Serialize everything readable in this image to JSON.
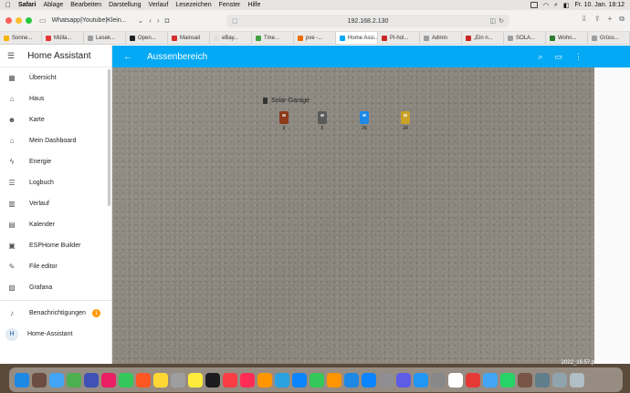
{
  "menubar": {
    "apple": "",
    "items": [
      "Safari",
      "Ablage",
      "Bearbeiten",
      "Darstellung",
      "Verlauf",
      "Lesezeichen",
      "Fenster",
      "Hilfe"
    ],
    "clock": "Fr. 10. Jan.  18:12"
  },
  "safari": {
    "tab_group": "Whatsapp|Youtube|Klein...",
    "url": "192.168.2.130",
    "bookmarks": [
      {
        "label": "Sonne...",
        "color": "#f4b400"
      },
      {
        "label": "Müllа...",
        "color": "#e53935"
      },
      {
        "label": "Lesek...",
        "color": "#9e9e9e"
      },
      {
        "label": "Open...",
        "color": "#222222"
      },
      {
        "label": "Mainsail",
        "color": "#d32f2f"
      },
      {
        "label": "eBay...",
        "color": "#e0e0e0"
      },
      {
        "label": "Tme...",
        "color": "#43a047"
      },
      {
        "label": "pve -...",
        "color": "#ef6c00"
      },
      {
        "label": "Home Assi...",
        "color": "#03a9f4"
      },
      {
        "label": "Pi-hol...",
        "color": "#c62828"
      },
      {
        "label": "Admin",
        "color": "#9e9e9e"
      },
      {
        "label": "„Ein n...",
        "color": "#c62828"
      },
      {
        "label": "SOLA...",
        "color": "#9e9e9e"
      },
      {
        "label": "Wohn...",
        "color": "#2e7d32"
      },
      {
        "label": "Grüss...",
        "color": "#9e9e9e"
      }
    ]
  },
  "sidebar": {
    "title": "Home Assistant",
    "items": [
      {
        "label": "Übersicht",
        "icon": "grid-icon",
        "glyph": "▦"
      },
      {
        "label": "Haus",
        "icon": "home-icon",
        "glyph": "⌂"
      },
      {
        "label": "Karte",
        "icon": "person-icon",
        "glyph": "☻"
      },
      {
        "label": "Mein Dashboard",
        "icon": "home-icon",
        "glyph": "⌂"
      },
      {
        "label": "Energie",
        "icon": "lightning-icon",
        "glyph": "ϟ"
      },
      {
        "label": "Logbuch",
        "icon": "list-icon",
        "glyph": "☰"
      },
      {
        "label": "Verlauf",
        "icon": "chart-icon",
        "glyph": "▥"
      },
      {
        "label": "Kalender",
        "icon": "calendar-icon",
        "glyph": "▤"
      },
      {
        "label": "ESPHome Builder",
        "icon": "chip-icon",
        "glyph": "▣"
      },
      {
        "label": "File editor",
        "icon": "wrench-icon",
        "glyph": "✎"
      },
      {
        "label": "Grafana",
        "icon": "graph-icon",
        "glyph": "▨"
      }
    ],
    "notifications": {
      "label": "Benachrichtigungen",
      "count": "1"
    },
    "user": {
      "label": "Home-Assistant",
      "initial": "H"
    }
  },
  "appbar": {
    "title": "Aussenbereich"
  },
  "card": {
    "group_title": "Solar-Garage",
    "entities": [
      {
        "name": "entity-1",
        "value": "9",
        "color": "#8b3a1a"
      },
      {
        "name": "entity-2",
        "value": "5",
        "color": "#5a5a5a"
      },
      {
        "name": "entity-3",
        "value": "26",
        "color": "#1e88e5"
      },
      {
        "name": "entity-4",
        "value": "24",
        "color": "#c9a227"
      }
    ]
  },
  "desktop": {
    "screenshot_label": "2022_16.57.pfx"
  }
}
